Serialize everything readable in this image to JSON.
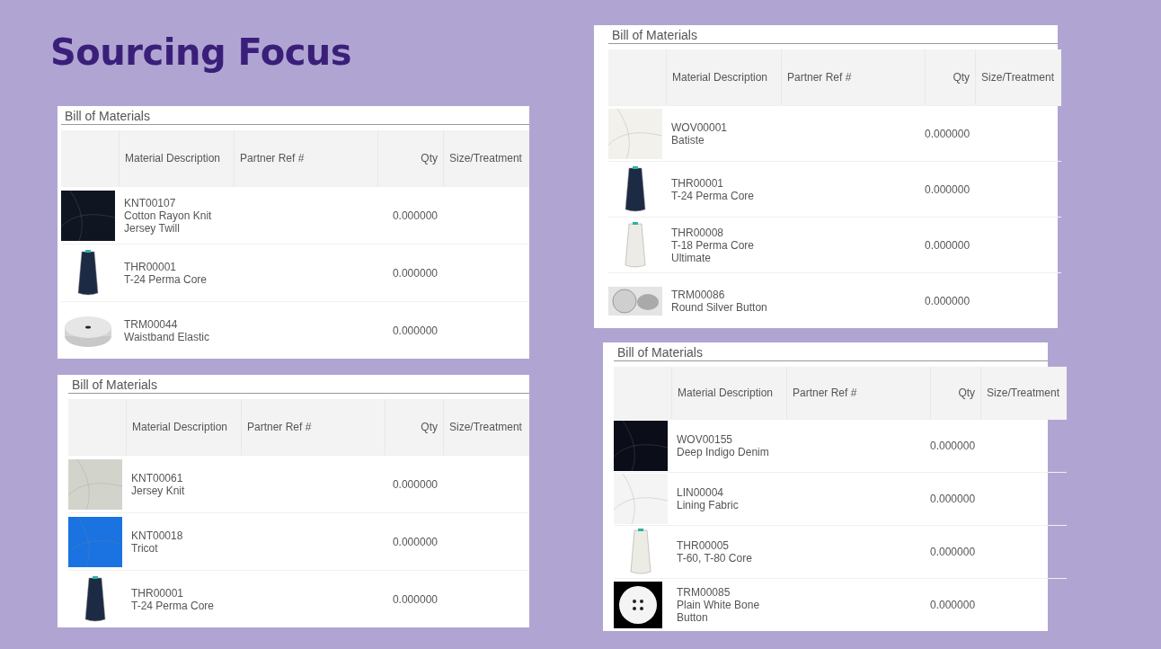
{
  "title": "Sourcing Focus",
  "panels": [
    {
      "title": "Bill of Materials",
      "columns": [
        "Material Description",
        "Partner Ref #",
        "Qty",
        "Size/Treatment"
      ],
      "rows": [
        {
          "thumb": {
            "kind": "fabric",
            "color": "#101522"
          },
          "code": "KNT00107",
          "name": "Cotton Rayon Knit Jersey Twill",
          "qty": "0.000000"
        },
        {
          "thumb": {
            "kind": "spool",
            "color": "#1c2a44"
          },
          "code": "THR00001",
          "name": "T-24 Perma Core",
          "qty": "0.000000"
        },
        {
          "thumb": {
            "kind": "roll",
            "color": "#e6e6e6"
          },
          "code": "TRM00044",
          "name": "Waistband Elastic",
          "qty": "0.000000"
        }
      ]
    },
    {
      "title": "Bill of Materials",
      "columns": [
        "Material Description",
        "Partner Ref #",
        "Qty",
        "Size/Treatment"
      ],
      "rows": [
        {
          "thumb": {
            "kind": "fabric",
            "color": "#d2d4cc"
          },
          "code": "KNT00061",
          "name": "Jersey Knit",
          "qty": "0.000000"
        },
        {
          "thumb": {
            "kind": "fabric",
            "color": "#1a73e0"
          },
          "code": "KNT00018",
          "name": "Tricot",
          "qty": "0.000000"
        },
        {
          "thumb": {
            "kind": "spool",
            "color": "#1c2a44"
          },
          "code": "THR00001",
          "name": "T-24 Perma Core",
          "qty": "0.000000"
        }
      ]
    },
    {
      "title": "Bill of Materials",
      "columns": [
        "Material Description",
        "Partner Ref #",
        "Qty",
        "Size/Treatment"
      ],
      "rows": [
        {
          "thumb": {
            "kind": "fabric",
            "color": "#f2f1ec"
          },
          "code": "WOV00001",
          "name": "Batiste",
          "qty": "0.000000"
        },
        {
          "thumb": {
            "kind": "spool",
            "color": "#1c2a44"
          },
          "code": "THR00001",
          "name": "T-24 Perma Core",
          "qty": "0.000000"
        },
        {
          "thumb": {
            "kind": "spool",
            "color": "#ecebe6"
          },
          "code": "THR00008",
          "name": "T-18 Perma Core Ultimate",
          "qty": "0.000000"
        },
        {
          "thumb": {
            "kind": "button-pair",
            "color": "#cfcfcf"
          },
          "code": "TRM00086",
          "name": "Round Silver Button",
          "qty": "0.000000"
        }
      ]
    },
    {
      "title": "Bill of Materials",
      "columns": [
        "Material Description",
        "Partner Ref #",
        "Qty",
        "Size/Treatment"
      ],
      "rows": [
        {
          "thumb": {
            "kind": "fabric",
            "color": "#0b0d18"
          },
          "code": "WOV00155",
          "name": "Deep Indigo Denim",
          "qty": "0.000000"
        },
        {
          "thumb": {
            "kind": "fabric",
            "color": "#f4f4f4"
          },
          "code": "LIN00004",
          "name": "Lining Fabric",
          "qty": "0.000000"
        },
        {
          "thumb": {
            "kind": "spool",
            "color": "#ecebe4"
          },
          "code": "THR00005",
          "name": "T-60, T-80 Core",
          "qty": "0.000000"
        },
        {
          "thumb": {
            "kind": "button",
            "color": "#f4f4f4"
          },
          "code": "TRM00085",
          "name": "Plain White Bone Button",
          "qty": "0.000000"
        }
      ]
    }
  ]
}
